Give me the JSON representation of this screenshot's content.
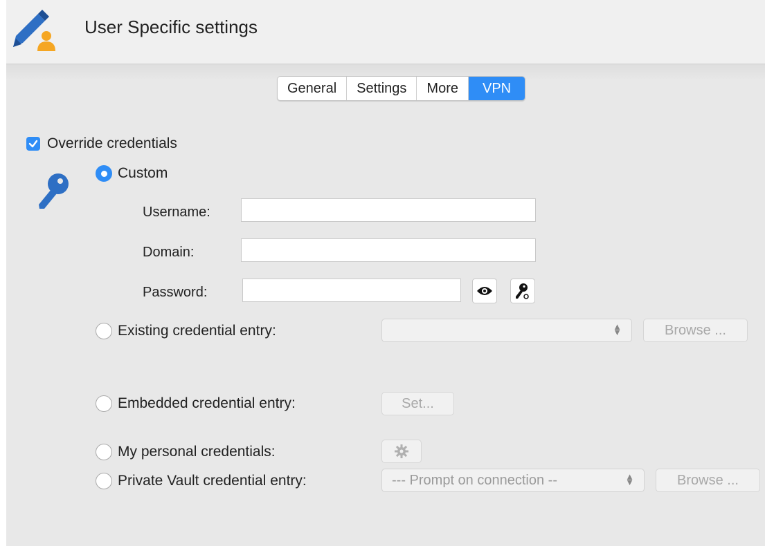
{
  "header": {
    "title": "User Specific settings",
    "icon": "pencil-user-icon"
  },
  "tabs": [
    {
      "label": "General",
      "active": false
    },
    {
      "label": "Settings",
      "active": false
    },
    {
      "label": "More",
      "active": false
    },
    {
      "label": "VPN",
      "active": true
    }
  ],
  "override": {
    "label": "Override credentials",
    "checked": true
  },
  "custom": {
    "label": "Custom",
    "selected": true,
    "icon": "key-icon",
    "username_label": "Username:",
    "username_value": "",
    "domain_label": "Domain:",
    "domain_value": "",
    "password_label": "Password:",
    "password_value": "",
    "show_password_icon": "eye-icon",
    "generate_password_icon": "key-generate-icon"
  },
  "existing": {
    "label": "Existing credential entry:",
    "selected": false,
    "select_value": "",
    "browse_label": "Browse ..."
  },
  "embedded": {
    "label": "Embedded credential entry:",
    "selected": false,
    "set_label": "Set..."
  },
  "personal": {
    "label": "My personal credentials:",
    "selected": false,
    "settings_icon": "gear-icon"
  },
  "private_vault": {
    "label": "Private Vault credential entry:",
    "selected": false,
    "select_value": "--- Prompt on connection --",
    "browse_label": "Browse ..."
  },
  "colors": {
    "accent": "#2f8df6",
    "background": "#e8e8e8",
    "header": "#f0f0f0"
  }
}
